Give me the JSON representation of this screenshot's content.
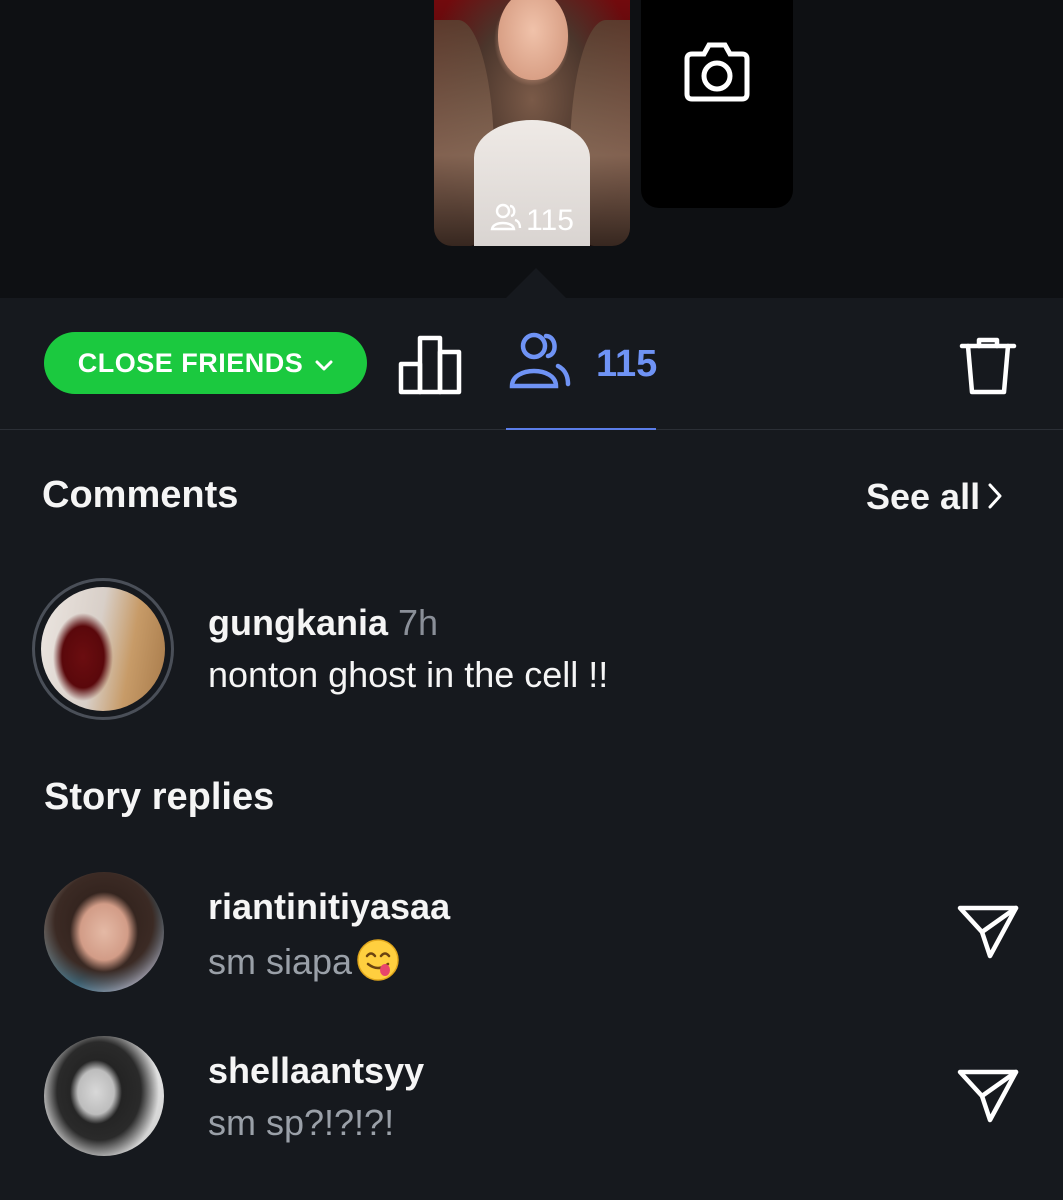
{
  "story": {
    "viewer_count": "115"
  },
  "toolbar": {
    "audience_label": "CLOSE FRIENDS",
    "viewers_count": "115"
  },
  "comments": {
    "title": "Comments",
    "see_all_label": "See all",
    "items": [
      {
        "username": "gungkania",
        "time": "7h",
        "text": "nonton ghost in the cell !!"
      }
    ]
  },
  "replies": {
    "title": "Story replies",
    "items": [
      {
        "username": "riantinitiyasaa",
        "text": "sm siapa",
        "emoji": "face-savoring-food"
      },
      {
        "username": "shellaantsyy",
        "text": "sm sp?!?!?!"
      }
    ]
  },
  "colors": {
    "close_friends": "#1bc93f",
    "accent_blue": "#6f93f5",
    "background": "#16191e"
  }
}
